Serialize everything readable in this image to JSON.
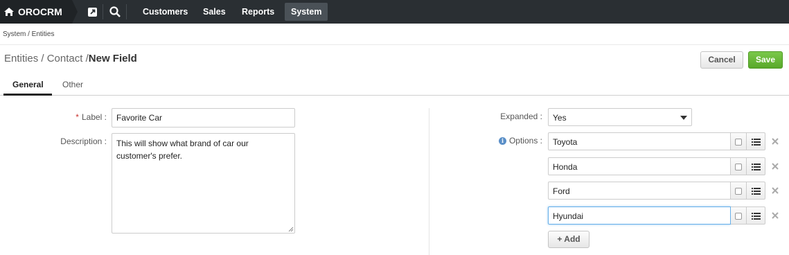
{
  "app": {
    "brand": "OROCRM"
  },
  "nav": {
    "items": [
      {
        "label": "Customers"
      },
      {
        "label": "Sales"
      },
      {
        "label": "Reports"
      },
      {
        "label": "System"
      }
    ]
  },
  "breadcrumb": "System / Entities",
  "title": {
    "part1": "Entities",
    "sep1": "/",
    "part2": "Contact",
    "sep2": "/",
    "current": "New Field"
  },
  "actions": {
    "cancel": "Cancel",
    "save": "Save"
  },
  "tabs": {
    "general": "General",
    "other": "Other"
  },
  "form": {
    "label_label": "Label :",
    "label_required": "*",
    "label_value": "Favorite Car",
    "description_label": "Description :",
    "description_value": "This will show what brand of car our customer's prefer.",
    "expanded_label": "Expanded :",
    "expanded_value": "Yes",
    "options_label": "Options :",
    "options": [
      "Toyota",
      "Honda",
      "Ford",
      "Hyundai"
    ],
    "add_label": "+ Add"
  },
  "colors": {
    "topbar": "#2a2f33",
    "save": "#5cb030",
    "accent": "#5a8fc8"
  }
}
